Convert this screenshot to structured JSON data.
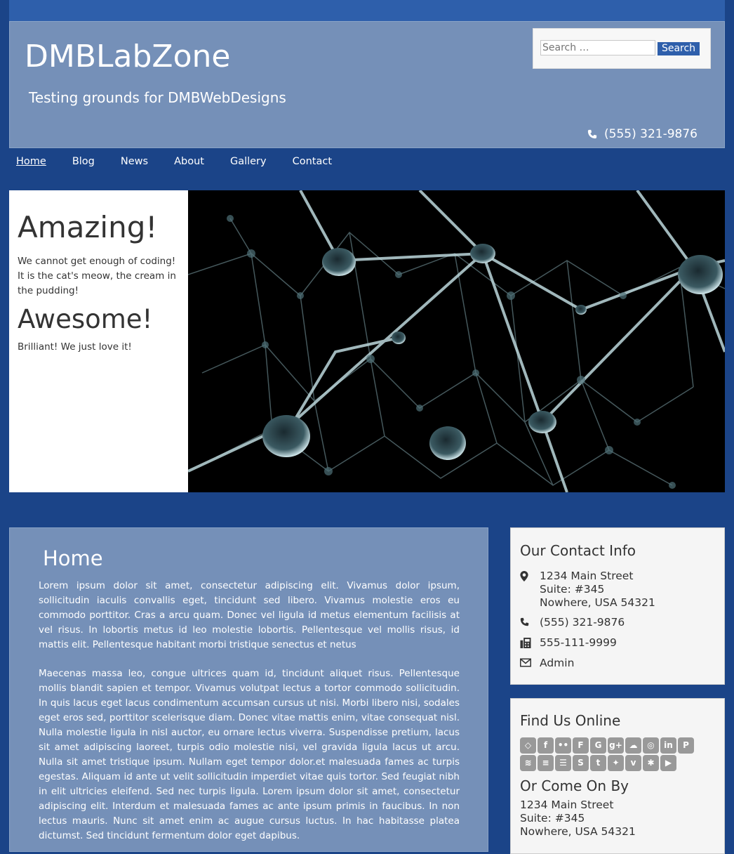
{
  "site": {
    "title": "DMBLabZone",
    "tagline": "Testing grounds for DMBWebDesigns",
    "phone": "(555) 321-9876"
  },
  "search": {
    "placeholder": "Search …",
    "button": "Search"
  },
  "nav": [
    "Home",
    "Blog",
    "News",
    "About",
    "Gallery",
    "Contact"
  ],
  "hero": {
    "heading1": "Amazing!",
    "text1": "We cannot get enough of coding! It is the cat's meow, the cream in the pudding!",
    "heading2": "Awesome!",
    "text2": "Brilliant! We just love it!"
  },
  "main": {
    "title": "Home",
    "p1": "Lorem ipsum dolor sit amet, consectetur adipiscing elit. Vivamus dolor ipsum, sollicitudin iaculis convallis eget, tincidunt sed libero. Vivamus molestie eros eu commodo porttitor. Cras a arcu quam. Donec vel ligula id metus elementum facilisis at vel risus. In lobortis metus id leo molestie lobortis. Pellentesque vel mollis risus, id mattis elit. Pellentesque habitant morbi tristique senectus et netus",
    "p2": "Maecenas massa leo, congue ultrices quam id, tincidunt aliquet risus. Pellentesque mollis blandit sapien et tempor. Vivamus volutpat lectus a tortor commodo sollicitudin. In quis lacus eget lacus condimentum accumsan cursus ut nisi. Morbi libero nisi, sodales eget eros sed, porttitor scelerisque diam. Donec vitae mattis enim, vitae consequat nisl. Nulla molestie ligula in nisl auctor, eu ornare lectus viverra. Suspendisse pretium, lacus sit amet adipiscing laoreet, turpis odio molestie nisi, vel gravida ligula lacus ut arcu. Nulla sit amet tristique ipsum. Nullam eget tempor dolor.et malesuada fames ac turpis egestas. Aliquam id ante ut velit sollicitudin imperdiet vitae quis tortor. Sed feugiat nibh in elit ultricies eleifend. Sed nec turpis ligula. Lorem ipsum dolor sit amet, consectetur adipiscing elit. Interdum et malesuada fames ac ante ipsum primis in faucibus. In non lectus mauris. Nunc sit amet enim ac augue cursus luctus. In hac habitasse platea dictumst. Sed tincidunt fermentum dolor eget dapibus."
  },
  "contact": {
    "title": "Our Contact Info",
    "address1": "1234 Main Street",
    "address2": "Suite: #345",
    "address3": "Nowhere, USA 54321",
    "phone": "(555) 321-9876",
    "fax": "555-111-9999",
    "email": "Admin"
  },
  "find": {
    "title": "Find Us Online",
    "icons": [
      "codepen-icon",
      "facebook-icon",
      "flickr-icon",
      "foursquare-icon",
      "github-icon",
      "google-plus-icon",
      "cloud-icon",
      "instagram-icon",
      "linkedin-icon",
      "pinterest-icon",
      "rss-icon",
      "stack-exchange-icon",
      "stack-overflow-icon",
      "stumbleupon-icon",
      "tumblr-icon",
      "twitter-icon",
      "vimeo-icon",
      "yelp-icon",
      "youtube-icon"
    ],
    "come_title": "Or Come On By",
    "address1": "1234 Main Street",
    "address2": "Suite: #345",
    "address3": "Nowhere, USA 54321"
  },
  "colors": {
    "background": "#1b4488",
    "header": "#7590b8",
    "accent": "#2e5fab"
  }
}
